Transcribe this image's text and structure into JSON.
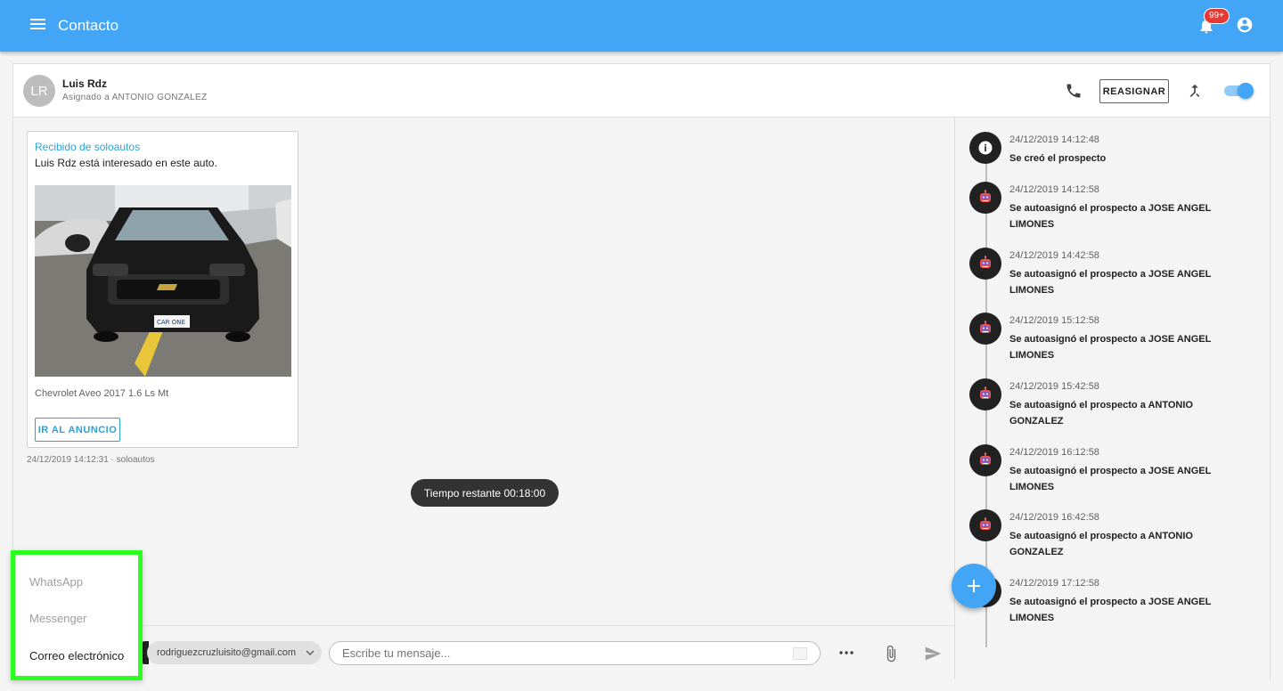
{
  "topbar": {
    "title": "Contacto",
    "notification_count": "99+",
    "icons": [
      "menu-icon",
      "bell-icon",
      "account-icon"
    ],
    "color": "#42a5f5"
  },
  "contact": {
    "initials": "LR",
    "name": "Luis Rdz",
    "assigned": "Asignado a ANTONIO GONZALEZ",
    "reassign_label": "REASIGNAR",
    "toggle_on": true
  },
  "message": {
    "source": "Recibido de soloautos",
    "text": "Luis Rdz está interesado en este auto.",
    "car_model": "Chevrolet Aveo 2017 1.6 Ls Mt",
    "plate_text": "CAR ONE",
    "button_label": "IR AL ANUNCIO",
    "meta": "24/12/2019 14:12:31 · soloautos"
  },
  "timer": "Tiempo restante 00:18:00",
  "composer": {
    "email": "rodriguezcruzluisito@gmail.com",
    "placeholder": "Escribe tu mensaje..."
  },
  "channel_menu": [
    {
      "label": "WhatsApp",
      "enabled": false
    },
    {
      "label": "Messenger",
      "enabled": false
    },
    {
      "label": "Correo electrónico",
      "enabled": true
    }
  ],
  "timeline": [
    {
      "date": "24/12/2019 14:12:48",
      "text": "Se creó el prospecto",
      "icon": "info-icon"
    },
    {
      "date": "24/12/2019 14:12:58",
      "text": "Se autoasignó el prospecto a JOSE ANGEL LIMONES",
      "icon": "robot-icon"
    },
    {
      "date": "24/12/2019 14:42:58",
      "text": "Se autoasignó el prospecto a JOSE ANGEL LIMONES",
      "icon": "robot-icon"
    },
    {
      "date": "24/12/2019 15:12:58",
      "text": "Se autoasignó el prospecto a JOSE ANGEL LIMONES",
      "icon": "robot-icon"
    },
    {
      "date": "24/12/2019 15:42:58",
      "text": "Se autoasignó el prospecto a ANTONIO GONZALEZ",
      "icon": "robot-icon"
    },
    {
      "date": "24/12/2019 16:12:58",
      "text": "Se autoasignó el prospecto a JOSE ANGEL LIMONES",
      "icon": "robot-icon"
    },
    {
      "date": "24/12/2019 16:42:58",
      "text": "Se autoasignó el prospecto a ANTONIO GONZALEZ",
      "icon": "robot-icon"
    },
    {
      "date": "24/12/2019 17:12:58",
      "text": "Se autoasignó el prospecto a JOSE ANGEL LIMONES",
      "icon": "robot-icon"
    }
  ]
}
